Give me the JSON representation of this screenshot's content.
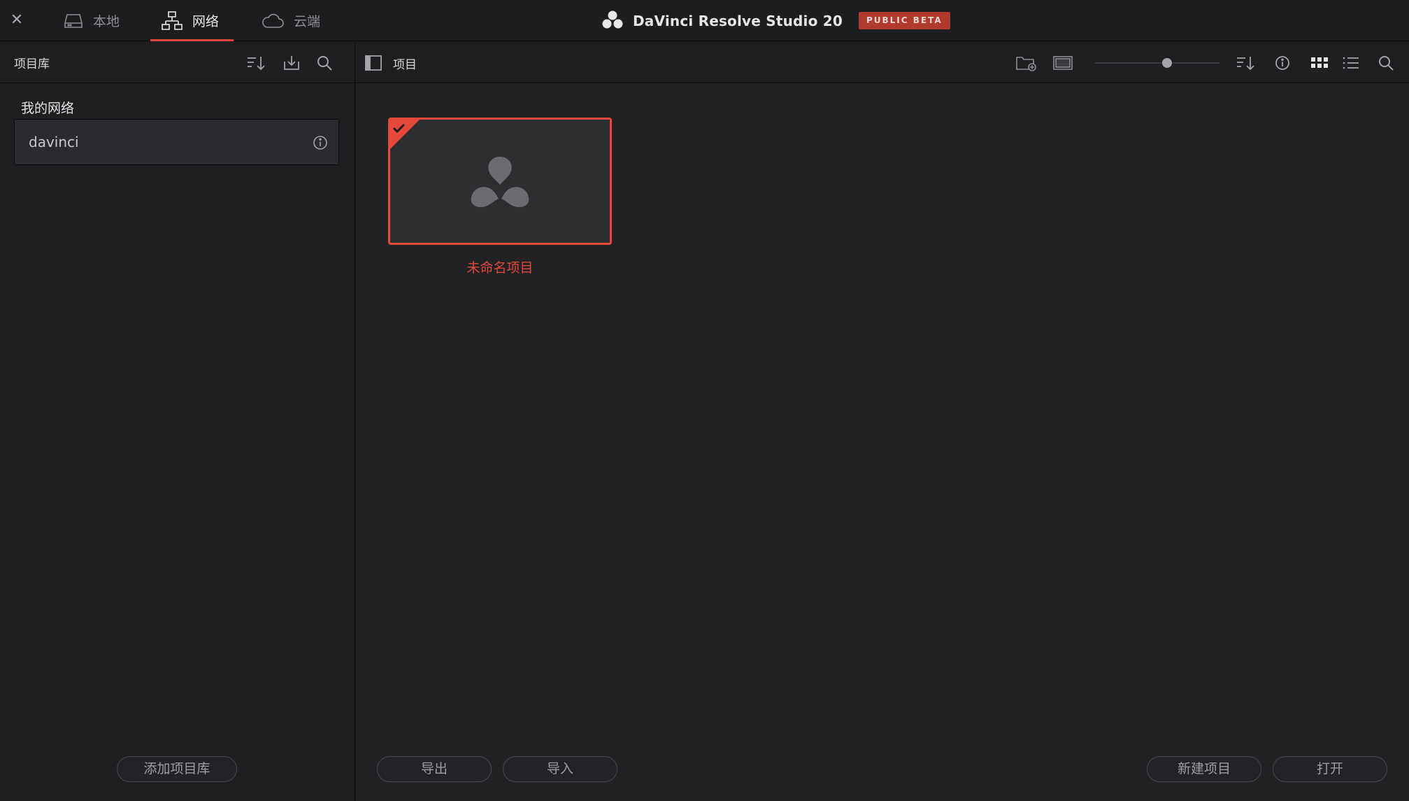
{
  "topbar": {
    "close_symbol": "✕",
    "tabs": [
      {
        "label": "本地",
        "icon": "drive-icon",
        "active": false
      },
      {
        "label": "网络",
        "icon": "network-icon",
        "active": true
      },
      {
        "label": "云端",
        "icon": "cloud-icon",
        "active": false
      }
    ],
    "app_title": "DaVinci Resolve Studio 20",
    "badge": "PUBLIC BETA"
  },
  "left_panel": {
    "title": "项目库",
    "section_label": "我的网络",
    "databases": [
      {
        "name": "davinci"
      }
    ],
    "add_button": "添加项目库"
  },
  "main_panel": {
    "title": "项目",
    "zoom_level": 0.55,
    "projects": [
      {
        "name": "未命名项目",
        "selected": true
      }
    ],
    "export_button": "导出",
    "import_button": "导入",
    "new_project_button": "新建项目",
    "open_button": "打开"
  },
  "colors": {
    "accent": "#e0473b",
    "badge_bg": "#b03a2e",
    "panel_bg": "#1f1f22"
  }
}
